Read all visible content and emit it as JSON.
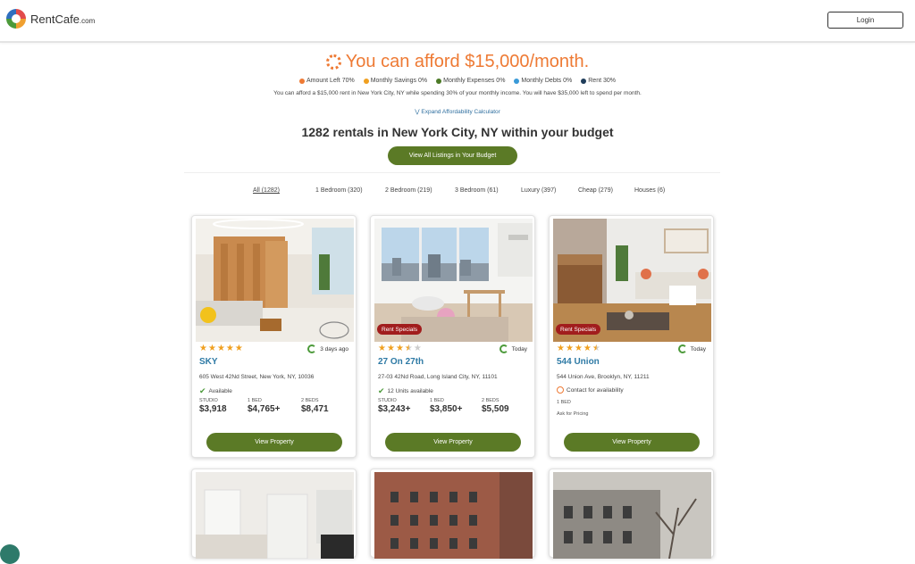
{
  "brand": {
    "name": "RentCafe",
    "suffix": ".com"
  },
  "header": {
    "login_label": "Login"
  },
  "affordability": {
    "title": "You can afford $15,000/month.",
    "legend": [
      {
        "label": "Amount Left",
        "value": "70%",
        "color": "#ee7a34"
      },
      {
        "label": "Monthly Savings",
        "value": "0%",
        "color": "#f0a020"
      },
      {
        "label": "Monthly Expenses",
        "value": "0%",
        "color": "#4c7a26"
      },
      {
        "label": "Monthly Debts",
        "value": "0%",
        "color": "#3a9ad8"
      },
      {
        "label": "Rent",
        "value": "30%",
        "color": "#1f3d5a"
      }
    ],
    "description": "You can afford a $15,000 rent in New York City, NY while spending 30% of your monthly income. You will have $35,000 left to spend per month.",
    "expand_label": "Expand Affordability Calculator"
  },
  "results": {
    "headline": "1282 rentals in New York City, NY within your budget",
    "view_all_label": "View All Listings in Your Budget"
  },
  "filters": [
    {
      "label": "All (1282)",
      "active": true
    },
    {
      "label": "1 Bedroom (320)",
      "active": false
    },
    {
      "label": "2 Bedroom (219)",
      "active": false
    },
    {
      "label": "3 Bedroom (61)",
      "active": false
    },
    {
      "label": "Luxury (397)",
      "active": false
    },
    {
      "label": "Cheap (279)",
      "active": false
    },
    {
      "label": "Houses (6)",
      "active": false
    }
  ],
  "listings": [
    {
      "name": "SKY",
      "address": "605 West 42Nd Street, New York, NY, 10036",
      "updated": "3 days ago",
      "rating": 5,
      "availability": "Available",
      "availability_icon": "checkmark-icon",
      "prices": [
        {
          "label": "STUDIO",
          "value": "$3,918"
        },
        {
          "label": "1 BED",
          "value": "$4,765+"
        },
        {
          "label": "2 BEDS",
          "value": "$8,471"
        }
      ],
      "button_label": "View Property"
    },
    {
      "name": "27 On 27th",
      "address": "27-03 42Nd Road, Long Island City, NY, 11101",
      "updated": "Today",
      "rating": 3.5,
      "badge": "Rent Specials",
      "availability": "12 Units available",
      "availability_icon": "checkmark-icon",
      "prices": [
        {
          "label": "STUDIO",
          "value": "$3,243+"
        },
        {
          "label": "1 BED",
          "value": "$3,850+"
        },
        {
          "label": "2 BEDS",
          "value": "$5,509"
        }
      ],
      "button_label": "View Property"
    },
    {
      "name": "544 Union",
      "address": "544 Union Ave, Brooklyn, NY, 11211",
      "updated": "Today",
      "rating": 4.5,
      "badge": "Rent Specials",
      "availability": "Contact for availability",
      "availability_icon": "clock-icon",
      "bed_label": "1 BED",
      "pricing_note": "Ask for Pricing",
      "button_label": "View Property"
    }
  ]
}
